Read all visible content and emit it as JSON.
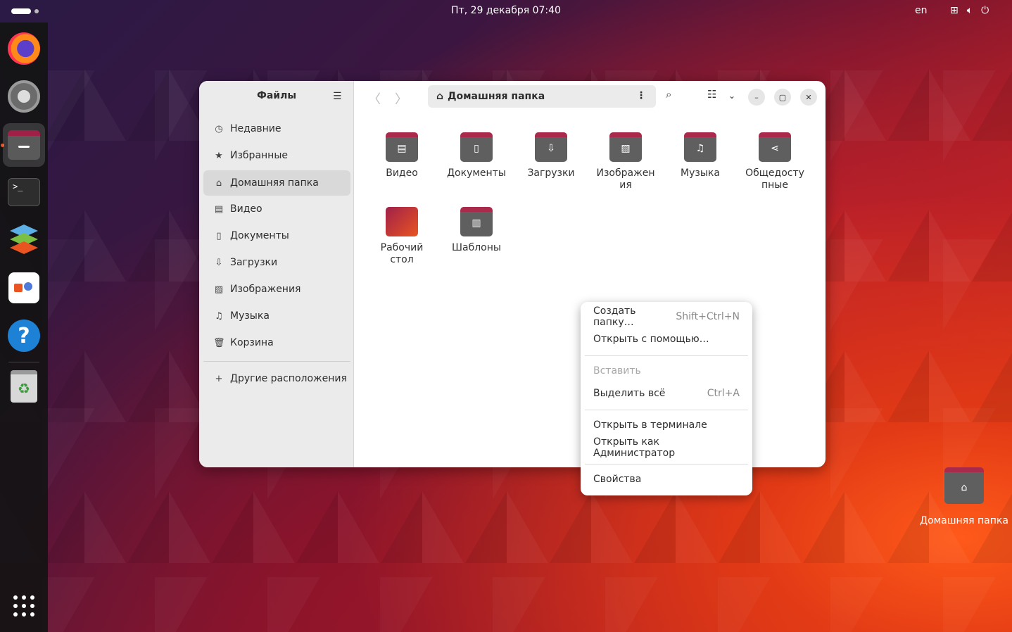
{
  "topbar": {
    "clock": "Пт, 29 декабря  07:40",
    "lang": "en"
  },
  "window": {
    "sidebar_title": "Файлы",
    "sidebar_items": [
      {
        "label": "Недавние",
        "icon": "clock-icon"
      },
      {
        "label": "Избранные",
        "icon": "star-icon"
      },
      {
        "label": "Домашняя папка",
        "icon": "home-icon",
        "selected": true
      },
      {
        "label": "Видео",
        "icon": "film-icon"
      },
      {
        "label": "Документы",
        "icon": "document-icon"
      },
      {
        "label": "Загрузки",
        "icon": "download-icon"
      },
      {
        "label": "Изображения",
        "icon": "image-icon"
      },
      {
        "label": "Музыка",
        "icon": "music-icon"
      },
      {
        "label": "Корзина",
        "icon": "trash-icon"
      }
    ],
    "other_locations": "Другие расположения",
    "path": "Домашняя папка",
    "folders": [
      {
        "line1": "Видео",
        "line2": ""
      },
      {
        "line1": "Документы",
        "line2": ""
      },
      {
        "line1": "Загрузки",
        "line2": ""
      },
      {
        "line1": "Изображен",
        "line2": "ия"
      },
      {
        "line1": "Музыка",
        "line2": ""
      },
      {
        "line1": "Общедосту",
        "line2": "пные"
      },
      {
        "line1": "Рабочий",
        "line2": "стол"
      },
      {
        "line1": "Шаблоны",
        "line2": ""
      }
    ]
  },
  "context_menu": {
    "items": [
      {
        "label": "Создать папку…",
        "accel": "Shift+Ctrl+N"
      },
      {
        "label": "Открыть с помощью…",
        "accel": ""
      },
      {
        "label": "Вставить",
        "accel": "",
        "disabled": true
      },
      {
        "label": "Выделить всё",
        "accel": "Ctrl+A"
      },
      {
        "label": "Открыть в терминале",
        "accel": ""
      },
      {
        "label": "Открыть как Администратор",
        "accel": ""
      },
      {
        "label": "Свойства",
        "accel": ""
      }
    ]
  },
  "desktop": {
    "home_label": "Домашняя папка"
  },
  "colors": {
    "accent": "#e95420",
    "folder_tab": "#a92a4a",
    "folder_body": "#5f5f5f"
  }
}
